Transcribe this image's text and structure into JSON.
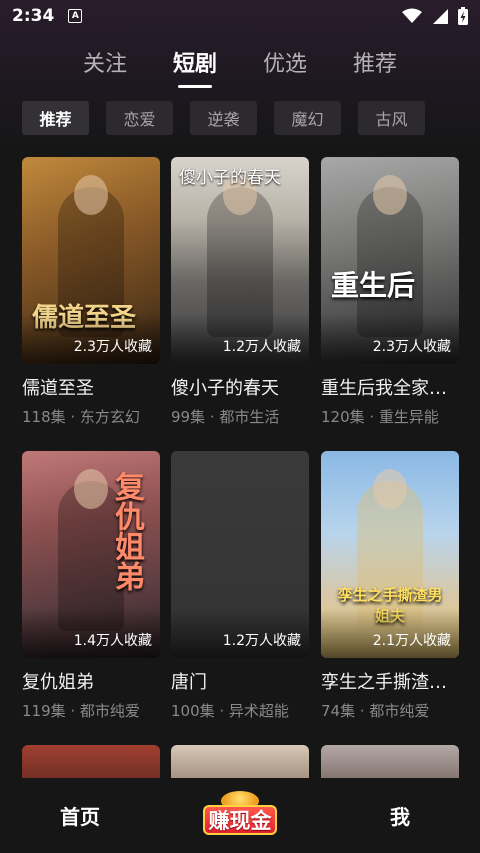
{
  "status_bar": {
    "time": "2:34",
    "notification_glyph": "A",
    "icons": [
      "wifi-icon",
      "signal-icon",
      "battery-charging-icon"
    ]
  },
  "top_tabs": [
    {
      "label": "关注",
      "active": false
    },
    {
      "label": "短剧",
      "active": true
    },
    {
      "label": "优选",
      "active": false
    },
    {
      "label": "推荐",
      "active": false
    }
  ],
  "chips": [
    {
      "label": "推荐",
      "active": true
    },
    {
      "label": "恋爱",
      "active": false
    },
    {
      "label": "逆袭",
      "active": false
    },
    {
      "label": "魔幻",
      "active": false
    },
    {
      "label": "古风",
      "active": false
    }
  ],
  "cards": [
    {
      "title": "儒道至圣",
      "meta": "118集 · 东方玄幻",
      "favorites": "2.3万人收藏",
      "poster_title": "",
      "poster_art": "儒道至圣"
    },
    {
      "title": "傻小子的春天",
      "meta": "99集 · 都市生活",
      "favorites": "1.2万人收藏",
      "poster_title": "傻小子的春天",
      "poster_art": ""
    },
    {
      "title": "重生后我全家…",
      "meta": "120集 · 重生异能",
      "favorites": "2.3万人收藏",
      "poster_title": "",
      "poster_art": "重生后"
    },
    {
      "title": "复仇姐弟",
      "meta": "119集 · 都市纯爱",
      "favorites": "1.4万人收藏",
      "poster_title": "",
      "poster_art": "复仇姐弟"
    },
    {
      "title": "唐门",
      "meta": "100集 · 异术超能",
      "favorites": "1.2万人收藏",
      "poster_title": "",
      "poster_art": ""
    },
    {
      "title": "孪生之手撕渣…",
      "meta": "74集 · 都市纯爱",
      "favorites": "2.1万人收藏",
      "poster_title": "",
      "poster_art": "孪生之手撕渣男姐夫"
    }
  ],
  "bottom_nav": {
    "home": "首页",
    "earn": "赚现金",
    "me": "我"
  }
}
